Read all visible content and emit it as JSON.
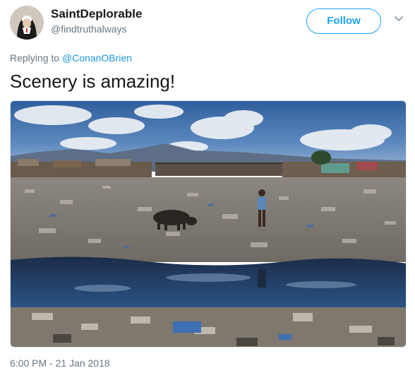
{
  "user": {
    "display_name": "SaintDeplorable",
    "handle": "@findtruthalways"
  },
  "actions": {
    "follow_label": "Follow",
    "menu_icon": "chevron-down-icon"
  },
  "reply": {
    "prefix": "Replying to",
    "mention": "@ConanOBrien"
  },
  "tweet": {
    "text": "Scenery is amazing!",
    "timestamp": "6:00 PM - 21 Jan 2018"
  },
  "colors": {
    "accent": "#1da1f2",
    "secondary_text": "#657786",
    "primary_text": "#14171a"
  }
}
